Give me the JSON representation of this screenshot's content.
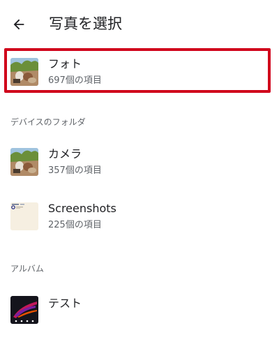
{
  "header": {
    "title": "写真を選択",
    "back_icon": "arrow-back-icon"
  },
  "items_top": [
    {
      "label": "フォト",
      "count": "697個の項目",
      "thumb_icon": "photo-thumbnail"
    }
  ],
  "sections": {
    "device_folders": "デバイスのフォルダ",
    "albums": "アルバム"
  },
  "device_folders": [
    {
      "label": "カメラ",
      "count": "357個の項目",
      "thumb_icon": "photo-thumbnail"
    },
    {
      "label": "Screenshots",
      "count": "225個の項目",
      "thumb_icon": "screenshot-thumbnail"
    }
  ],
  "albums": [
    {
      "label": "テスト",
      "thumb_icon": "wallpaper-thumbnail"
    }
  ],
  "colors": {
    "highlight": "#d0021b"
  }
}
